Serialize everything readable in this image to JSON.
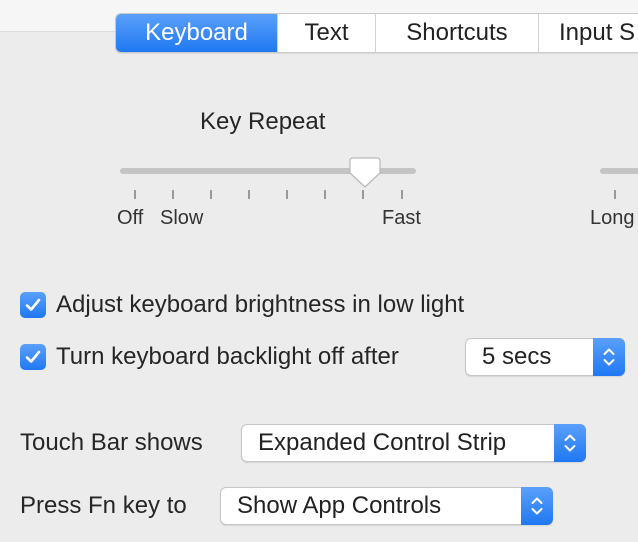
{
  "tabs": [
    {
      "label": "Keyboard",
      "active": true
    },
    {
      "label": "Text",
      "active": false
    },
    {
      "label": "Shortcuts",
      "active": false
    },
    {
      "label": "Input S",
      "active": false
    }
  ],
  "key_repeat": {
    "title": "Key Repeat",
    "labels": {
      "off": "Off",
      "slow": "Slow",
      "fast": "Fast"
    },
    "tick_count": 8,
    "value_fraction": 0.86
  },
  "delay_until_repeat": {
    "labels": {
      "long": "Long"
    }
  },
  "options": {
    "brightness": {
      "label": "Adjust keyboard brightness in low light",
      "checked": true
    },
    "backlight": {
      "label": "Turn keyboard backlight off after",
      "checked": true,
      "value": "5 secs"
    }
  },
  "touch_bar": {
    "label": "Touch Bar shows",
    "value": "Expanded Control Strip"
  },
  "fn_key": {
    "label": "Press Fn key to",
    "value": "Show App Controls"
  },
  "colors": {
    "accent": "#1f78f2",
    "track": "#c4c4c4",
    "background": "#ececec"
  }
}
